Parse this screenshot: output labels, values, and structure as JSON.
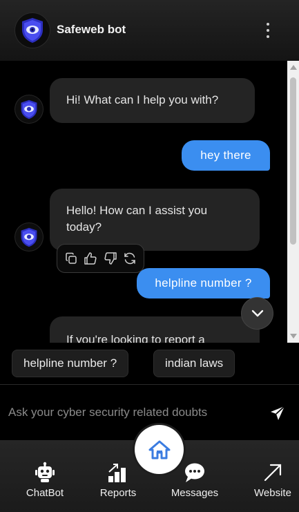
{
  "header": {
    "title": "Safeweb bot"
  },
  "messages": [
    {
      "role": "bot",
      "text": "Hi! What can I help you with?"
    },
    {
      "role": "user",
      "text": "hey there"
    },
    {
      "role": "bot",
      "text": "Hello! How can I assist you today?"
    },
    {
      "role": "user",
      "text": "helpline number ?"
    },
    {
      "role": "bot",
      "text": "If you're looking to report a"
    }
  ],
  "message_actions": [
    "copy-icon",
    "thumbs-up-icon",
    "thumbs-down-icon",
    "regenerate-icon"
  ],
  "suggestions": [
    {
      "label": "helpline number ?"
    },
    {
      "label": "indian laws"
    }
  ],
  "input": {
    "placeholder": "Ask your cyber security related doubts",
    "value": ""
  },
  "nav": [
    {
      "label": "ChatBot",
      "icon": "robot-icon"
    },
    {
      "label": "Reports",
      "icon": "chart-icon"
    },
    {
      "label": "Messages",
      "icon": "chat-bubble-icon"
    },
    {
      "label": "Website",
      "icon": "external-arrow-icon"
    }
  ],
  "colors": {
    "user_bubble": "#3b8ef0",
    "bot_bubble": "#242424",
    "shield": "#4a4ef0",
    "home_icon": "#3b7ce0"
  }
}
